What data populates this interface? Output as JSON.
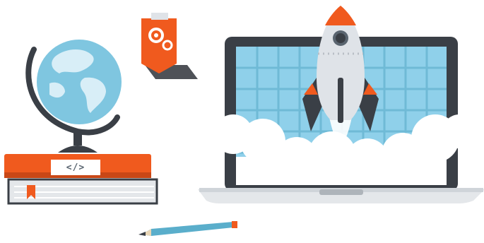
{
  "books": {
    "code_label": "</>"
  },
  "colors": {
    "accent": "#f05a1e",
    "sky": "#8fd0ea",
    "grid": "#6fbad6",
    "laptop_frame": "#3a3f46",
    "rocket_body": "#dfe3e8",
    "globe_ocean": "#7fc6e0",
    "globe_land": "#d8eef7",
    "book_top": "#f05a1e",
    "book_bottom": "#e4e7ea"
  },
  "icons": [
    "gear-tag-icon",
    "globe-icon",
    "rocket-icon",
    "laptop-icon",
    "pencil-icon",
    "bookmark-icon"
  ]
}
